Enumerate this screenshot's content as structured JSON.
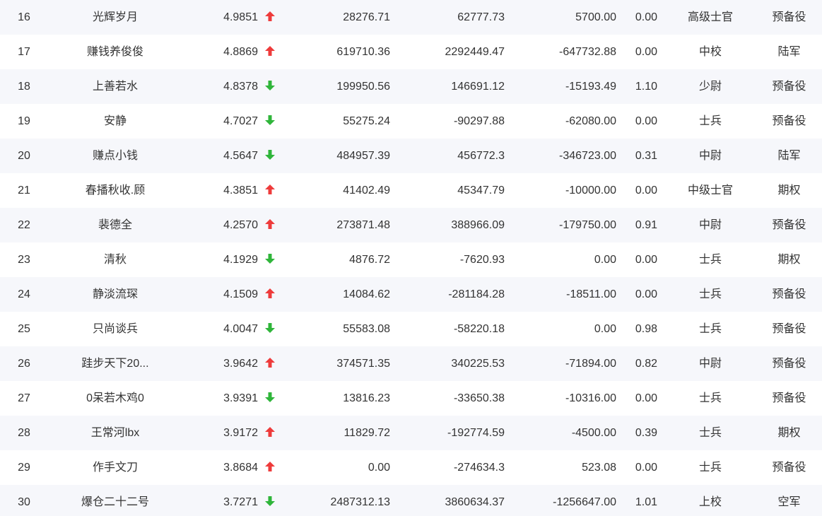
{
  "colors": {
    "up": "#ee3b3b",
    "down": "#2fb53a",
    "stripe": "#f6f7fb",
    "text": "#333333"
  },
  "rows": [
    {
      "rank": "16",
      "name": "光辉岁月",
      "score": "4.9851",
      "trend": "up",
      "v1": "28276.71",
      "v2": "62777.73",
      "v3": "5700.00",
      "ratio": "0.00",
      "level": "高级士官",
      "type": "预备役"
    },
    {
      "rank": "17",
      "name": "赚钱养俊俊",
      "score": "4.8869",
      "trend": "up",
      "v1": "619710.36",
      "v2": "2292449.47",
      "v3": "-647732.88",
      "ratio": "0.00",
      "level": "中校",
      "type": "陆军"
    },
    {
      "rank": "18",
      "name": "上善若水",
      "score": "4.8378",
      "trend": "down",
      "v1": "199950.56",
      "v2": "146691.12",
      "v3": "-15193.49",
      "ratio": "1.10",
      "level": "少尉",
      "type": "预备役"
    },
    {
      "rank": "19",
      "name": "安静",
      "score": "4.7027",
      "trend": "down",
      "v1": "55275.24",
      "v2": "-90297.88",
      "v3": "-62080.00",
      "ratio": "0.00",
      "level": "士兵",
      "type": "预备役"
    },
    {
      "rank": "20",
      "name": "赚点小钱",
      "score": "4.5647",
      "trend": "down",
      "v1": "484957.39",
      "v2": "456772.3",
      "v3": "-346723.00",
      "ratio": "0.31",
      "level": "中尉",
      "type": "陆军"
    },
    {
      "rank": "21",
      "name": "春播秋收.顾",
      "score": "4.3851",
      "trend": "up",
      "v1": "41402.49",
      "v2": "45347.79",
      "v3": "-10000.00",
      "ratio": "0.00",
      "level": "中级士官",
      "type": "期权"
    },
    {
      "rank": "22",
      "name": "裴德全",
      "score": "4.2570",
      "trend": "up",
      "v1": "273871.48",
      "v2": "388966.09",
      "v3": "-179750.00",
      "ratio": "0.91",
      "level": "中尉",
      "type": "预备役"
    },
    {
      "rank": "23",
      "name": "清秋",
      "score": "4.1929",
      "trend": "down",
      "v1": "4876.72",
      "v2": "-7620.93",
      "v3": "0.00",
      "ratio": "0.00",
      "level": "士兵",
      "type": "期权"
    },
    {
      "rank": "24",
      "name": "静淡流琛",
      "score": "4.1509",
      "trend": "up",
      "v1": "14084.62",
      "v2": "-281184.28",
      "v3": "-18511.00",
      "ratio": "0.00",
      "level": "士兵",
      "type": "预备役"
    },
    {
      "rank": "25",
      "name": "只尚谈兵",
      "score": "4.0047",
      "trend": "down",
      "v1": "55583.08",
      "v2": "-58220.18",
      "v3": "0.00",
      "ratio": "0.98",
      "level": "士兵",
      "type": "预备役"
    },
    {
      "rank": "26",
      "name": "跬步天下20...",
      "score": "3.9642",
      "trend": "up",
      "v1": "374571.35",
      "v2": "340225.53",
      "v3": "-71894.00",
      "ratio": "0.82",
      "level": "中尉",
      "type": "预备役"
    },
    {
      "rank": "27",
      "name": "0呆若木鸡0",
      "score": "3.9391",
      "trend": "down",
      "v1": "13816.23",
      "v2": "-33650.38",
      "v3": "-10316.00",
      "ratio": "0.00",
      "level": "士兵",
      "type": "预备役"
    },
    {
      "rank": "28",
      "name": "王常河lbx",
      "score": "3.9172",
      "trend": "up",
      "v1": "11829.72",
      "v2": "-192774.59",
      "v3": "-4500.00",
      "ratio": "0.39",
      "level": "士兵",
      "type": "期权"
    },
    {
      "rank": "29",
      "name": "作手文刀",
      "score": "3.8684",
      "trend": "up",
      "v1": "0.00",
      "v2": "-274634.3",
      "v3": "523.08",
      "ratio": "0.00",
      "level": "士兵",
      "type": "预备役"
    },
    {
      "rank": "30",
      "name": "爆仓二十二号",
      "score": "3.7271",
      "trend": "down",
      "v1": "2487312.13",
      "v2": "3860634.37",
      "v3": "-1256647.00",
      "ratio": "1.01",
      "level": "上校",
      "type": "空军"
    }
  ]
}
